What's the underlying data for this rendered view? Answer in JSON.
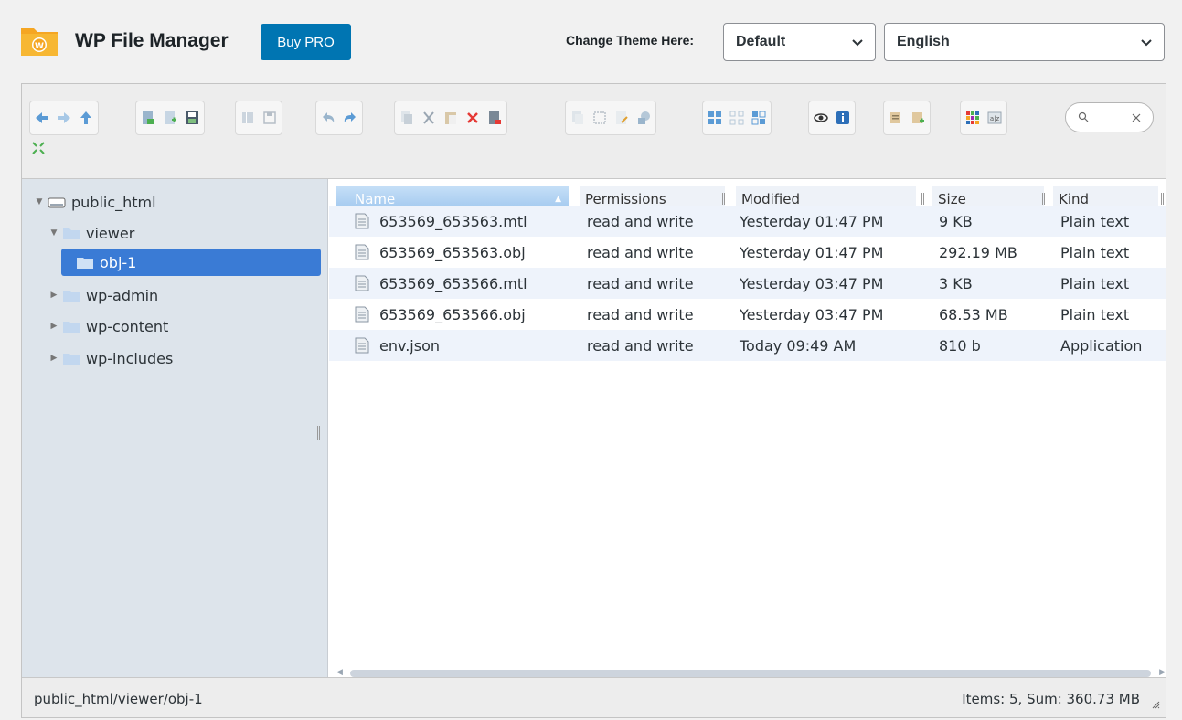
{
  "header": {
    "title": "WP File Manager",
    "buy_pro": "Buy PRO",
    "theme_label": "Change Theme Here:",
    "theme_value": "Default",
    "language_value": "English"
  },
  "toolbar": {
    "groups": [
      [
        "back-icon",
        "forward-icon",
        "up-icon"
      ],
      [
        "reload-icon",
        "new-file-icon",
        "save-icon"
      ],
      [
        "open-icon",
        "edit-icon"
      ],
      [
        "undo-icon",
        "redo-icon"
      ],
      [
        "copy-icon",
        "cut-icon",
        "paste-icon",
        "delete-icon",
        "empty-icon"
      ],
      [
        "duplicate-icon",
        "rename-icon",
        "archive-icon",
        "upload-icon"
      ],
      [
        "view-icons-icon",
        "view-list-icon",
        "view-tiles-icon"
      ],
      [
        "preview-icon",
        "info-icon"
      ],
      [
        "extract-icon",
        "compress-icon"
      ],
      [
        "select-all-icon",
        "sort-icon"
      ]
    ],
    "second_row": [
      "fullscreen-icon"
    ]
  },
  "tree": {
    "root": "public_html",
    "items": [
      {
        "label": "viewer",
        "level": 1,
        "expanded": true
      },
      {
        "label": "obj-1",
        "level": 2,
        "selected": true
      },
      {
        "label": "wp-admin",
        "level": 1
      },
      {
        "label": "wp-content",
        "level": 1
      },
      {
        "label": "wp-includes",
        "level": 1
      }
    ]
  },
  "table": {
    "headers": {
      "name": "Name",
      "permissions": "Permissions",
      "modified": "Modified",
      "size": "Size",
      "kind": "Kind"
    },
    "rows": [
      {
        "name": "653569_653563.mtl",
        "permissions": "read and write",
        "modified": "Yesterday 01:47 PM",
        "size": "9 KB",
        "kind": "Plain text"
      },
      {
        "name": "653569_653563.obj",
        "permissions": "read and write",
        "modified": "Yesterday 01:47 PM",
        "size": "292.19 MB",
        "kind": "Plain text"
      },
      {
        "name": "653569_653566.mtl",
        "permissions": "read and write",
        "modified": "Yesterday 03:47 PM",
        "size": "3 KB",
        "kind": "Plain text"
      },
      {
        "name": "653569_653566.obj",
        "permissions": "read and write",
        "modified": "Yesterday 03:47 PM",
        "size": "68.53 MB",
        "kind": "Plain text"
      },
      {
        "name": "env.json",
        "permissions": "read and write",
        "modified": "Today 09:49 AM",
        "size": "810 b",
        "kind": "Application"
      }
    ]
  },
  "status": {
    "path": "public_html/viewer/obj-1",
    "summary": "Items: 5, Sum: 360.73 MB"
  },
  "colors": {
    "accent": "#0075b2",
    "selected": "#3a7bd5",
    "navbar_bg": "#dde4eb"
  }
}
